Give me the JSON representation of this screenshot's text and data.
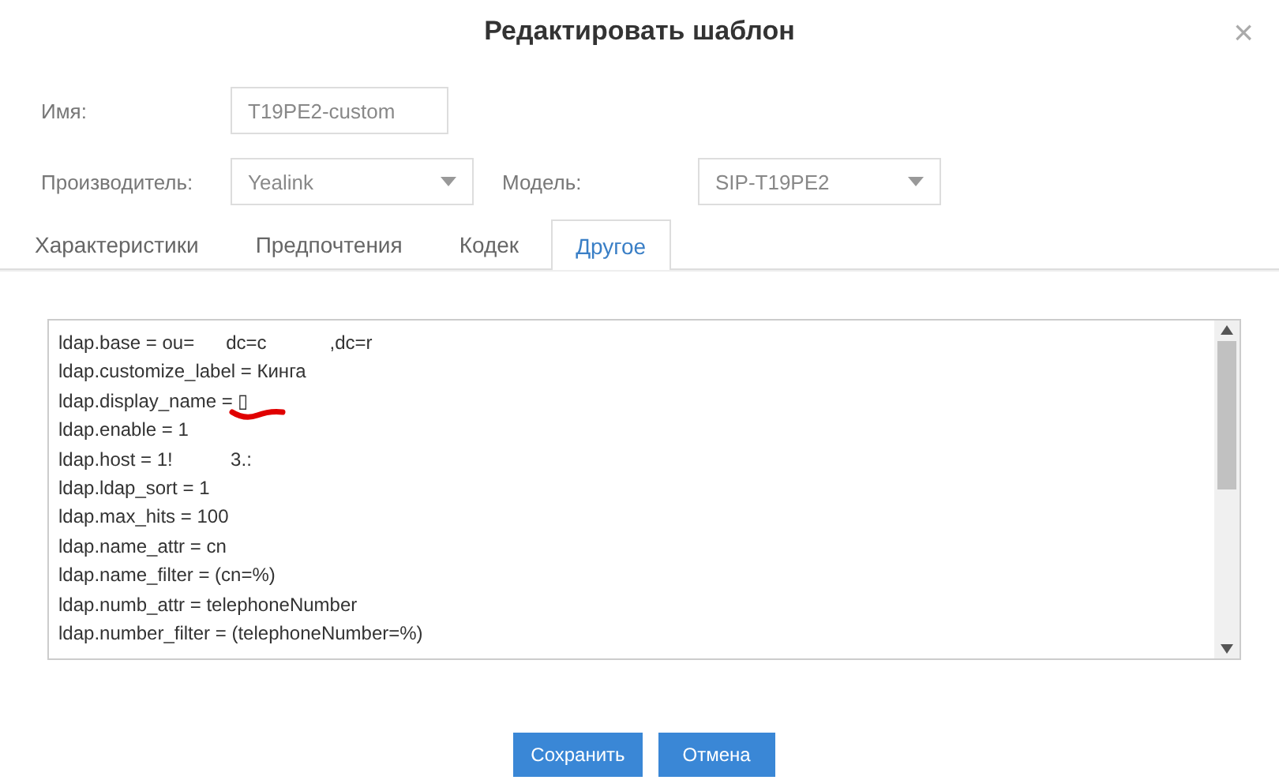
{
  "window": {
    "title": "Редактировать шаблон",
    "close": "×"
  },
  "fields": [
    {
      "label": "Имя:",
      "value": "T19PE2-custom"
    }
  ],
  "selects": [
    {
      "label": "Производитель:",
      "value": "Yealink"
    },
    {
      "label": "Модель:",
      "value": "SIP-T19PE2"
    }
  ],
  "tabs": [
    {
      "label": "Характеристики",
      "selected": false
    },
    {
      "label": "Предпочтения",
      "selected": false
    },
    {
      "label": "Кодек",
      "selected": false
    },
    {
      "label": "Другое",
      "selected": true
    }
  ],
  "config_lines": [
    "ldap.base = ou=      dc=c            ,dc=r",
    "ldap.customize_label = Кинга",
    "ldap.display_name = ▯",
    "ldap.enable = 1",
    "ldap.host = 1!           3.:",
    "ldap.ldap_sort = 1",
    "ldap.max_hits = 100",
    "ldap.name_attr = cn",
    "ldap.name_filter = (cn=%)",
    "ldap.numb_attr = telephoneNumber",
    "ldap.number_filter = (telephoneNumber=%)"
  ],
  "buttons": [
    "Сохранить",
    "Отмена"
  ]
}
